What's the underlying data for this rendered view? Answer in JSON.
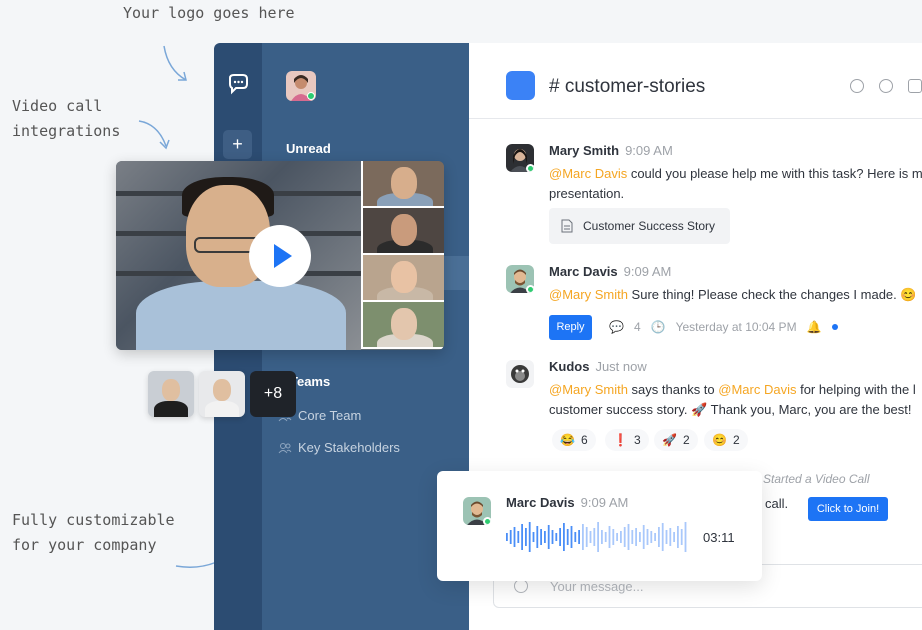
{
  "annotations": {
    "logo": "Your logo goes here",
    "video_line1": "Video call",
    "video_line2": "integrations",
    "custom_line1": "Fully customizable",
    "custom_line2": "for your company"
  },
  "sidebar": {
    "unread_label": "Unread",
    "teams_label": "Teams",
    "items": [
      {
        "label": "Core Team",
        "icon": "team-icon"
      },
      {
        "label": "Key Stakeholders",
        "icon": "team-icon"
      }
    ]
  },
  "rail": {
    "plus_label": "+"
  },
  "channel": {
    "name": "# customer-stories"
  },
  "messages": [
    {
      "author": "Mary Smith",
      "time": "9:09 AM",
      "mention": "@Marc Davis",
      "text1": " could you please help me with this task? Here is m",
      "text2": "presentation.",
      "attachment": "Customer Success Story"
    },
    {
      "author": "Marc Davis",
      "time": "9:09 AM",
      "mention": "@Mary Smith",
      "text1": " Sure thing! Please check the changes I made. 😊",
      "reply_label": "Reply",
      "reply_count": "4",
      "last_reply": "Yesterday at 10:04 PM"
    },
    {
      "author": "Kudos",
      "time": "Just now",
      "mention1": "@Mary Smith",
      "text_mid": " says thanks to ",
      "mention2": "@Marc Davis",
      "text_end": " for helping with the l",
      "text2": "customer success story. 🚀 Thank you, Marc, you are the best!",
      "reactions": [
        {
          "emoji": "😂",
          "count": "6"
        },
        {
          "emoji": "❗",
          "count": "3"
        },
        {
          "emoji": "🚀",
          "count": "2"
        },
        {
          "emoji": "😊",
          "count": "2"
        }
      ]
    }
  ],
  "video_call": {
    "status": "Started a Video Call",
    "text": "call.",
    "join_label": "Click to Join!"
  },
  "composer": {
    "placeholder": "Your message..."
  },
  "audio": {
    "author": "Marc Davis",
    "time": "9:09 AM",
    "duration": "03:11"
  },
  "participants": {
    "more": "+8"
  },
  "colors": {
    "accent": "#1d74f5",
    "sidebar": "#3a5f87",
    "mention": "#f5a623"
  }
}
